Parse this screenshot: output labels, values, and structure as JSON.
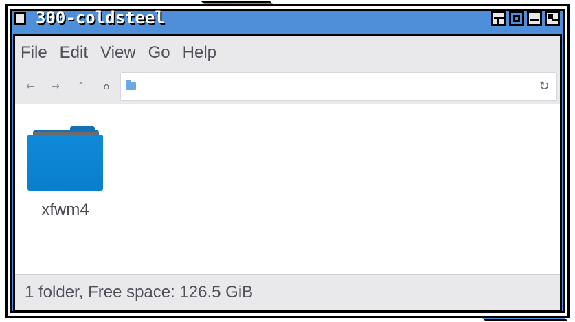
{
  "window": {
    "title": "300-coldsteel",
    "buttons": [
      "shade-icon",
      "maximize-icon",
      "minimize-icon",
      "close-icon"
    ]
  },
  "menubar": {
    "items": [
      {
        "label": "File"
      },
      {
        "label": "Edit"
      },
      {
        "label": "View"
      },
      {
        "label": "Go"
      },
      {
        "label": "Help"
      }
    ]
  },
  "toolbar": {
    "back": "←",
    "forward": "→",
    "up": "⌃",
    "home": "⌂",
    "reload": "↻",
    "location": ""
  },
  "content": {
    "items": [
      {
        "name": "xfwm4",
        "type": "folder"
      }
    ]
  },
  "status": {
    "text": "1 folder, Free space: 126.5 GiB"
  },
  "colors": {
    "accent": "#4f8ed9",
    "folder": "#0a7fcc"
  }
}
